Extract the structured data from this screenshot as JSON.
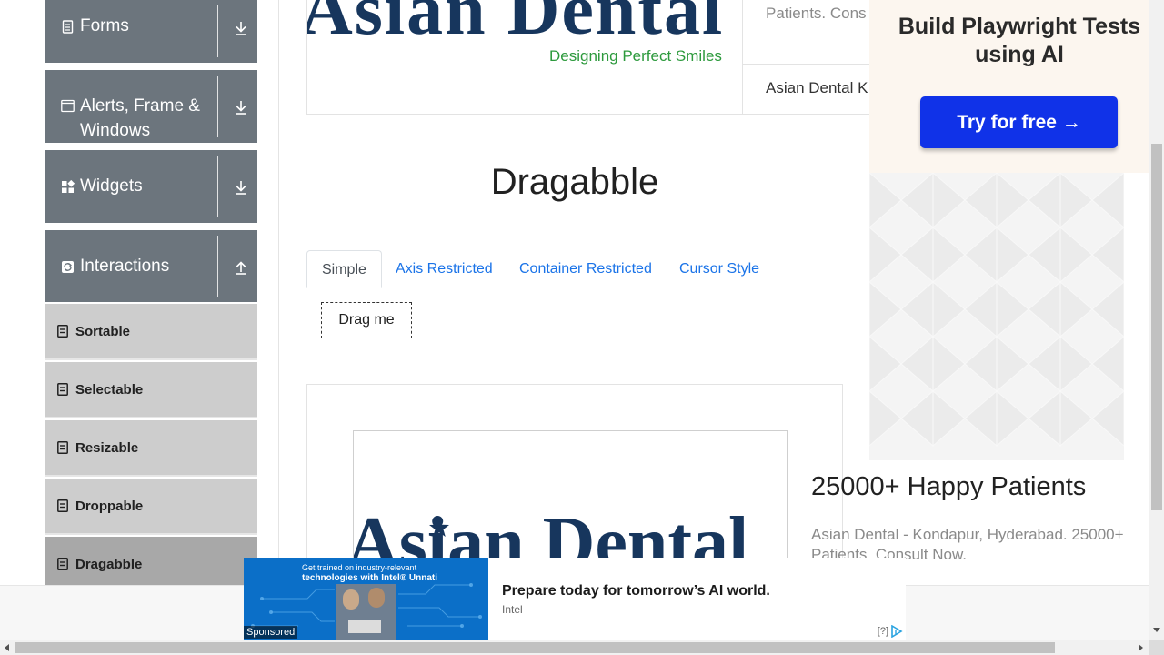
{
  "sidebar": {
    "groups": [
      {
        "label": "Forms",
        "icon": "document-icon",
        "arrow": "download-arrow-icon"
      },
      {
        "label": "Alerts, Frame & Windows",
        "icon": "window-icon",
        "arrow": "download-arrow-icon"
      },
      {
        "label": "Widgets",
        "icon": "widgets-icon",
        "arrow": "download-arrow-icon"
      },
      {
        "label": "Interactions",
        "icon": "interactions-icon",
        "arrow": "upload-arrow-icon"
      }
    ],
    "items": [
      {
        "label": "Sortable"
      },
      {
        "label": "Selectable"
      },
      {
        "label": "Resizable"
      },
      {
        "label": "Droppable"
      },
      {
        "label": "Dragabble",
        "active": true
      }
    ]
  },
  "top_ad": {
    "logo_text": "Asian Dental",
    "logo_tagline": "Designing Perfect Smiles",
    "line1": "Patients. Cons",
    "line2": "Asian Dental K"
  },
  "right_ad": {
    "title": "Build Playwright Tests using AI",
    "button": "Try for free →"
  },
  "main": {
    "title": "Dragabble",
    "tabs": [
      {
        "label": "Simple",
        "active": true
      },
      {
        "label": "Axis Restricted"
      },
      {
        "label": "Container Restricted"
      },
      {
        "label": "Cursor Style"
      }
    ],
    "drag_box": "Drag me"
  },
  "bottom_ad": {
    "logo_text": "Asian Dental",
    "headline": "25000+ Happy Patients",
    "description": "Asian Dental - Kondapur, Hyderabad. 25000+ Patients. Consult Now."
  },
  "banner": {
    "image_text_line1": "Get trained on industry-relevant",
    "image_text_line2": "technologies with Intel® Unnati",
    "sponsored": "Sponsored",
    "headline": "Prepare today for tomorrow’s AI world.",
    "brand": "Intel",
    "adchoice": "[?]"
  },
  "colors": {
    "sidebar_group": "#6c757d",
    "sidebar_item": "#cdcdcd",
    "sidebar_item_active": "#a8a8a8",
    "link": "#1a73e8",
    "cta": "#1032e8",
    "logo_navy": "#17365d",
    "logo_green": "#2d9a3d"
  }
}
